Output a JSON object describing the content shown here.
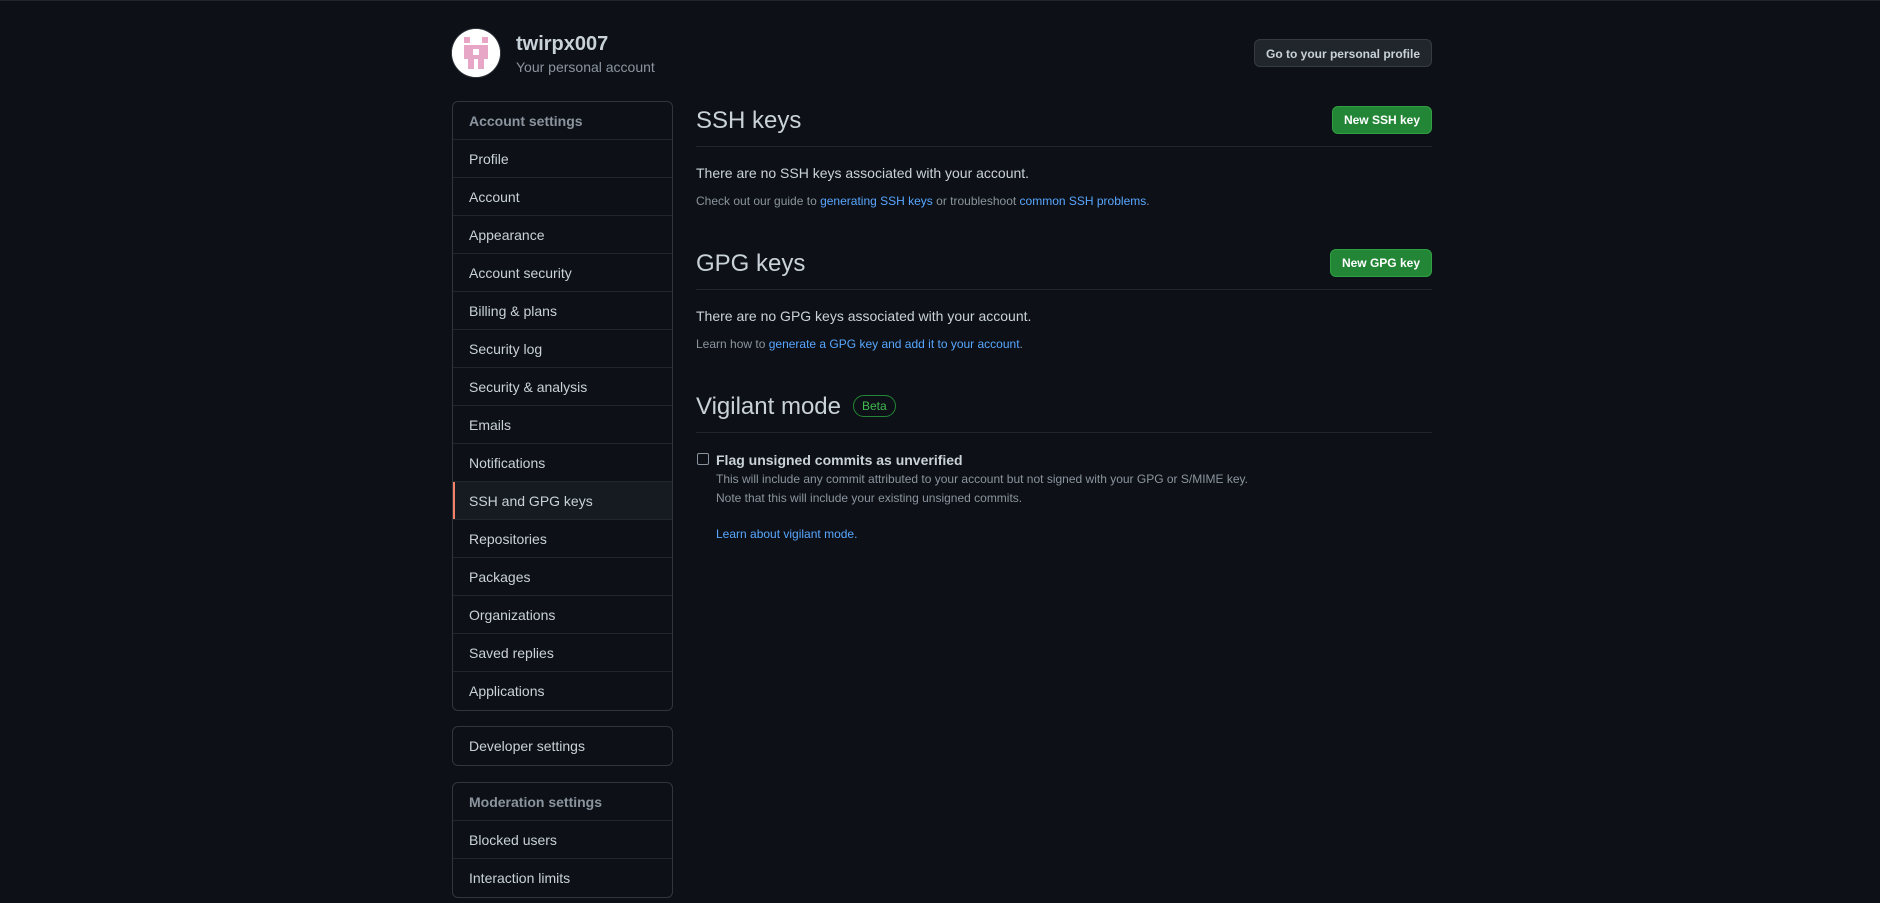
{
  "header": {
    "username": "twirpx007",
    "subtitle": "Your personal account",
    "profile_button": "Go to your personal profile"
  },
  "sidebar": {
    "account_settings": {
      "heading": "Account settings",
      "items": [
        {
          "label": "Profile"
        },
        {
          "label": "Account"
        },
        {
          "label": "Appearance"
        },
        {
          "label": "Account security"
        },
        {
          "label": "Billing & plans"
        },
        {
          "label": "Security log"
        },
        {
          "label": "Security & analysis"
        },
        {
          "label": "Emails"
        },
        {
          "label": "Notifications"
        },
        {
          "label": "SSH and GPG keys",
          "selected": true
        },
        {
          "label": "Repositories"
        },
        {
          "label": "Packages"
        },
        {
          "label": "Organizations"
        },
        {
          "label": "Saved replies"
        },
        {
          "label": "Applications"
        }
      ]
    },
    "developer_settings": {
      "label": "Developer settings"
    },
    "moderation_settings": {
      "heading": "Moderation settings",
      "items": [
        {
          "label": "Blocked users"
        },
        {
          "label": "Interaction limits"
        }
      ]
    }
  },
  "ssh": {
    "title": "SSH keys",
    "button": "New SSH key",
    "empty": "There are no SSH keys associated with your account.",
    "note_prefix": "Check out our guide to ",
    "link1": "generating SSH keys",
    "note_middle": " or troubleshoot ",
    "link2": "common SSH problems",
    "note_suffix": "."
  },
  "gpg": {
    "title": "GPG keys",
    "button": "New GPG key",
    "empty": "There are no GPG keys associated with your account.",
    "note_prefix": "Learn how to ",
    "link": "generate a GPG key and add it to your account",
    "note_suffix": "."
  },
  "vigilant": {
    "title": "Vigilant mode",
    "badge": "Beta",
    "checkbox_label": "Flag unsigned commits as unverified",
    "checked": false,
    "note_line1": "This will include any commit attributed to your account but not signed with your GPG or S/MIME key.",
    "note_line2": "Note that this will include your existing unsigned commits.",
    "learn_link": "Learn about vigilant mode."
  },
  "colors": {
    "background": "#0d1117",
    "border": "#30363d",
    "text": "#c9d1d9",
    "muted": "#8b949e",
    "link": "#58a6ff",
    "green_button": "#238636",
    "selected_accent": "#f78166",
    "avatar_pink": "#e7a6c6"
  }
}
